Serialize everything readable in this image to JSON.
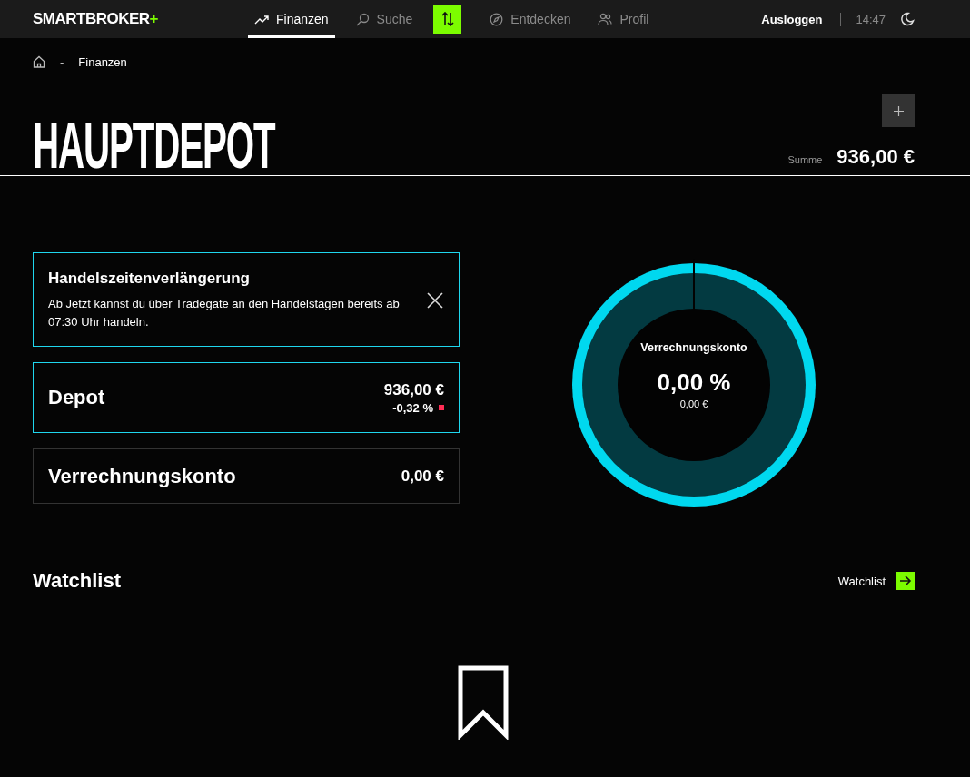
{
  "header": {
    "logo": {
      "name": "SMARTBROKER",
      "mark": "+"
    },
    "nav": [
      {
        "label": "Finanzen",
        "selected": true
      },
      {
        "label": "Suche",
        "selected": false
      },
      {
        "label": "Entdecken",
        "selected": false
      },
      {
        "label": "Profil",
        "selected": false
      }
    ],
    "logout": "Ausloggen",
    "time": "14:47"
  },
  "breadcrumb": {
    "separator": "-",
    "items": [
      "Finanzen"
    ]
  },
  "page_title": "HAUPTDEPOT",
  "sum": {
    "label": "Summe",
    "value": "936,00 €"
  },
  "notice": {
    "title": "Handelszeitenverlängerung",
    "text": "Ab Jetzt kannst du über Tradegate an den Handelstagen bereits ab 07:30 Uhr handeln."
  },
  "accounts": [
    {
      "name": "Depot",
      "value": "936,00 €",
      "change": "-0,32 %",
      "negative": true,
      "selected": true
    },
    {
      "name": "Verrechnungskonto",
      "value": "0,00 €",
      "selected": false
    }
  ],
  "donut": {
    "label": "Verrechnungskonto",
    "percent": "0,00 %",
    "amount": "0,00 €"
  },
  "watchlist": {
    "title": "Watchlist",
    "link": "Watchlist"
  }
}
